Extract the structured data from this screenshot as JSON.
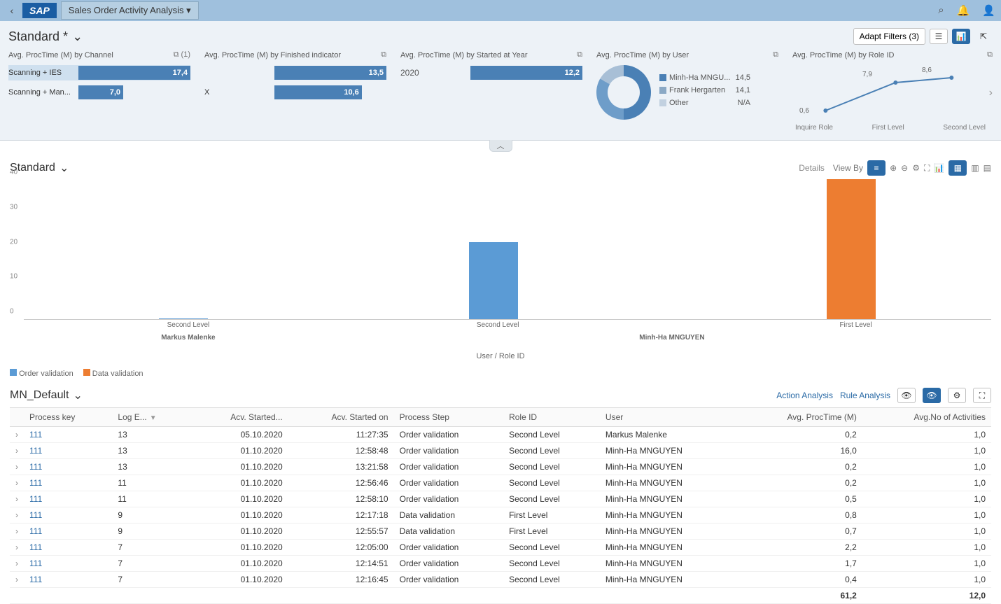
{
  "header": {
    "title": "Sales Order Activity Analysis"
  },
  "filter": {
    "variant": "Standard *",
    "adapt_filters": "Adapt Filters (3)"
  },
  "kpi1": {
    "title": "Avg. ProcTime (M) by Channel",
    "count": "(1)",
    "r1_label": "Scanning + IES",
    "r1_val": "17,4",
    "r2_label": "Scanning + Man...",
    "r2_val": "7,0"
  },
  "kpi2": {
    "title": "Avg. ProcTime (M) by Finished indicator",
    "r1_label": "",
    "r1_val": "13,5",
    "r2_label": "X",
    "r2_val": "10,6"
  },
  "kpi3": {
    "title": "Avg. ProcTime (M) by Started at Year",
    "year": "2020",
    "val": "12,2"
  },
  "kpi4": {
    "title": "Avg. ProcTime (M) by User",
    "l1_name": "Minh-Ha MNGU...",
    "l1_val": "14,5",
    "l2_name": "Frank Hergarten",
    "l2_val": "14,1",
    "l3_name": "Other",
    "l3_val": "N/A"
  },
  "kpi5": {
    "title": "Avg. ProcTime (M) by Role ID",
    "v1": "0,6",
    "v2": "7,9",
    "v3": "8,6",
    "x1": "Inquire Role",
    "x2": "First Level",
    "x3": "Second Level"
  },
  "chart": {
    "variant": "Standard",
    "details": "Details",
    "view_by": "View By",
    "axis_title": "User / Role ID",
    "legend1": "Order validation",
    "legend2": "Data validation",
    "user1": "Markus Malenke",
    "user2": "Minh-Ha MNGUYEN",
    "role1": "Second Level",
    "role2": "Second Level",
    "role3": "First Level"
  },
  "chart_data": {
    "type": "bar",
    "ylim": [
      0,
      40
    ],
    "categories": [
      "Markus Malenke / Second Level",
      "Minh-Ha MNGUYEN / Second Level",
      "Minh-Ha MNGUYEN / First Level"
    ],
    "series": [
      {
        "name": "Order validation",
        "values": [
          0.2,
          22,
          null
        ]
      },
      {
        "name": "Data validation",
        "values": [
          null,
          null,
          40
        ]
      }
    ]
  },
  "table": {
    "variant": "MN_Default",
    "action_analysis": "Action Analysis",
    "rule_analysis": "Rule Analysis",
    "cols": {
      "c1": "Process key",
      "c2": "Log E...",
      "c3": "Acv. Started...",
      "c4": "Acv. Started on",
      "c5": "Process Step",
      "c6": "Role ID",
      "c7": "User",
      "c8": "Avg. ProcTime (M)",
      "c9": "Avg.No of Activities"
    },
    "rows": [
      {
        "key": "111",
        "log": "13",
        "d": "05.10.2020",
        "t": "11:27:35",
        "step": "Order validation",
        "role": "Second Level",
        "user": "Markus Malenke",
        "proc": "0,2",
        "act": "1,0"
      },
      {
        "key": "111",
        "log": "13",
        "d": "01.10.2020",
        "t": "12:58:48",
        "step": "Order validation",
        "role": "Second Level",
        "user": "Minh-Ha MNGUYEN",
        "proc": "16,0",
        "act": "1,0"
      },
      {
        "key": "111",
        "log": "13",
        "d": "01.10.2020",
        "t": "13:21:58",
        "step": "Order validation",
        "role": "Second Level",
        "user": "Minh-Ha MNGUYEN",
        "proc": "0,2",
        "act": "1,0"
      },
      {
        "key": "111",
        "log": "11",
        "d": "01.10.2020",
        "t": "12:56:46",
        "step": "Order validation",
        "role": "Second Level",
        "user": "Minh-Ha MNGUYEN",
        "proc": "0,2",
        "act": "1,0"
      },
      {
        "key": "111",
        "log": "11",
        "d": "01.10.2020",
        "t": "12:58:10",
        "step": "Order validation",
        "role": "Second Level",
        "user": "Minh-Ha MNGUYEN",
        "proc": "0,5",
        "act": "1,0"
      },
      {
        "key": "111",
        "log": "9",
        "d": "01.10.2020",
        "t": "12:17:18",
        "step": "Data validation",
        "role": "First Level",
        "user": "Minh-Ha MNGUYEN",
        "proc": "0,8",
        "act": "1,0"
      },
      {
        "key": "111",
        "log": "9",
        "d": "01.10.2020",
        "t": "12:55:57",
        "step": "Data validation",
        "role": "First Level",
        "user": "Minh-Ha MNGUYEN",
        "proc": "0,7",
        "act": "1,0"
      },
      {
        "key": "111",
        "log": "7",
        "d": "01.10.2020",
        "t": "12:05:00",
        "step": "Order validation",
        "role": "Second Level",
        "user": "Minh-Ha MNGUYEN",
        "proc": "2,2",
        "act": "1,0"
      },
      {
        "key": "111",
        "log": "7",
        "d": "01.10.2020",
        "t": "12:14:51",
        "step": "Order validation",
        "role": "Second Level",
        "user": "Minh-Ha MNGUYEN",
        "proc": "1,7",
        "act": "1,0"
      },
      {
        "key": "111",
        "log": "7",
        "d": "01.10.2020",
        "t": "12:16:45",
        "step": "Order validation",
        "role": "Second Level",
        "user": "Minh-Ha MNGUYEN",
        "proc": "0,4",
        "act": "1,0"
      }
    ],
    "totals": {
      "proc": "61,2",
      "act": "12,0"
    }
  }
}
